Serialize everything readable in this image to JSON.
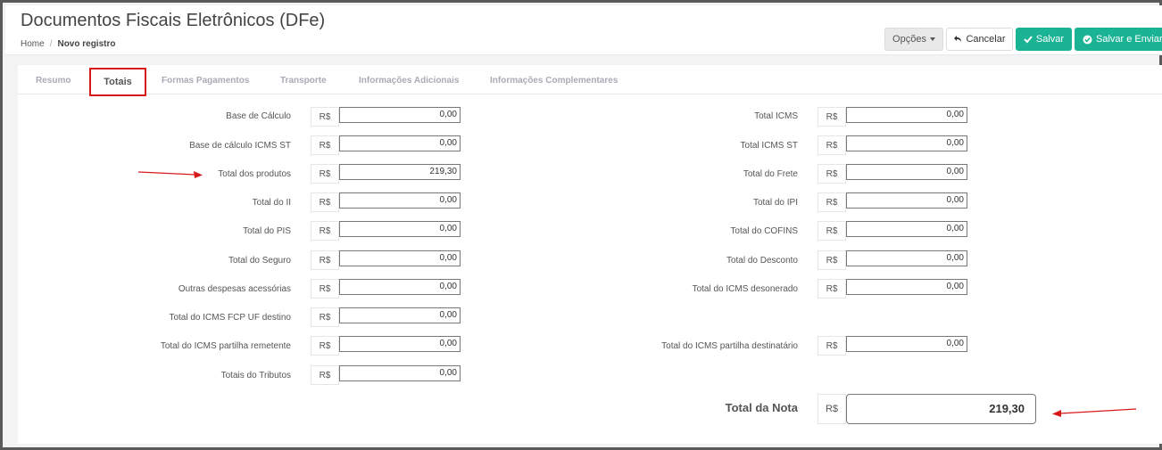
{
  "header": {
    "title": "Documentos Fiscais Eletrônicos (DFe)",
    "breadcrumb": {
      "home": "Home",
      "separator": "/",
      "current": "Novo registro"
    }
  },
  "toolbar": {
    "options_label": "Opções",
    "cancel_label": "Cancelar",
    "save_label": "Salvar",
    "save_send_label": "Salvar e Enviar"
  },
  "tabs": [
    "Resumo",
    "Totais",
    "Formas Pagamentos",
    "Transporte",
    "Informações Adicionais",
    "Informações Complementares"
  ],
  "currency": "R$",
  "left_fields": [
    {
      "label": "Base de Cálculo",
      "value": "0,00"
    },
    {
      "label": "Base de cálculo ICMS ST",
      "value": "0,00"
    },
    {
      "label": "Total dos produtos",
      "value": "219,30"
    },
    {
      "label": "Total do II",
      "value": "0,00"
    },
    {
      "label": "Total do PIS",
      "value": "0,00"
    },
    {
      "label": "Total do Seguro",
      "value": "0,00"
    },
    {
      "label": "Outras despesas acessórias",
      "value": "0,00"
    },
    {
      "label": "Total do ICMS FCP UF destino",
      "value": "0,00"
    },
    {
      "label": "Total do ICMS partilha remetente",
      "value": "0,00"
    },
    {
      "label": "Totais do Tributos",
      "value": "0,00"
    }
  ],
  "right_fields": [
    {
      "label": "Total ICMS",
      "value": "0,00"
    },
    {
      "label": "Total ICMS ST",
      "value": "0,00"
    },
    {
      "label": "Total do Frete",
      "value": "0,00"
    },
    {
      "label": "Total do IPI",
      "value": "0,00"
    },
    {
      "label": "Total do COFINS",
      "value": "0,00"
    },
    {
      "label": "Total do Desconto",
      "value": "0,00"
    },
    {
      "label": "Total do ICMS desonerado",
      "value": "0,00"
    },
    {
      "label": "Total do ICMS partilha destinatário",
      "value": "0,00"
    }
  ],
  "total_nota": {
    "label": "Total da Nota",
    "value": "219,30"
  },
  "colors": {
    "accent": "#1ab394",
    "highlight": "#d7191a",
    "annotation_arrow": "#d7191a"
  }
}
